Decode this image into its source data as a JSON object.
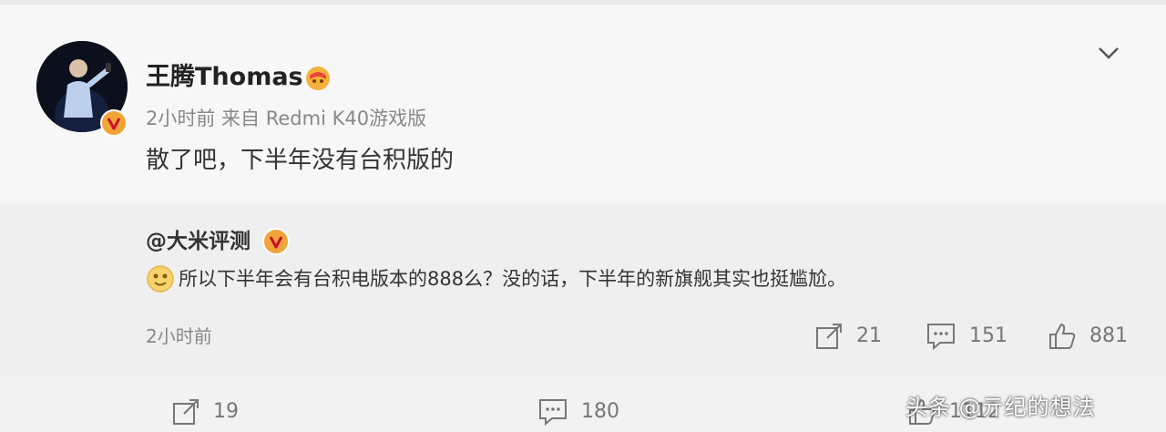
{
  "post": {
    "username": "王腾Thomas",
    "meta": "2小时前  来自 Redmi K40游戏版",
    "text": "散了吧，下半年没有台积版的"
  },
  "repost": {
    "author": "@大米评测",
    "text": "所以下半年会有台积电版本的888么？没的话，下半年的新旗舰其实也挺尴尬。",
    "time": "2小时前",
    "actions": {
      "share_count": "21",
      "comment_count": "151",
      "like_count": "881"
    }
  },
  "bottom_actions": {
    "share_count": "19",
    "comment_count": "180",
    "like_count": "1112"
  },
  "watermark": "头条 @亓纪的想法",
  "colors": {
    "badge": "#f1a43a",
    "vip_icon": "#e8453c",
    "text_muted": "#888888"
  }
}
